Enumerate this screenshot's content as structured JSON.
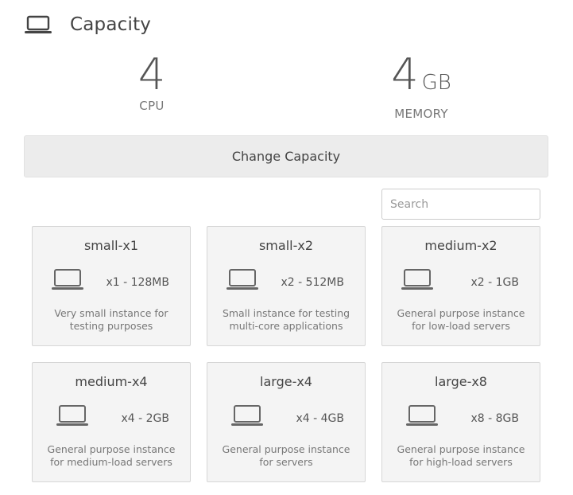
{
  "header": {
    "title": "Capacity",
    "icon": "laptop-icon"
  },
  "metrics": {
    "cpu": {
      "value": "4",
      "label": "CPU"
    },
    "memory": {
      "value": "4",
      "unit": "GB",
      "label": "MEMORY"
    }
  },
  "change_button": {
    "label": "Change Capacity"
  },
  "search": {
    "placeholder": "Search",
    "value": ""
  },
  "flavors": [
    {
      "name": "small-x1",
      "spec": "x1 - 128MB",
      "description": "Very small instance for testing purposes",
      "icon": "laptop-icon"
    },
    {
      "name": "small-x2",
      "spec": "x2 - 512MB",
      "description": "Small instance for testing multi-core applications",
      "icon": "laptop-icon"
    },
    {
      "name": "medium-x2",
      "spec": "x2 - 1GB",
      "description": "General purpose instance for low-load servers",
      "icon": "laptop-icon"
    },
    {
      "name": "medium-x4",
      "spec": "x4 - 2GB",
      "description": "General purpose instance for medium-load servers",
      "icon": "laptop-icon"
    },
    {
      "name": "large-x4",
      "spec": "x4 - 4GB",
      "description": "General purpose instance for servers",
      "icon": "laptop-icon"
    },
    {
      "name": "large-x8",
      "spec": "x8 - 8GB",
      "description": "General purpose instance for high-load servers",
      "icon": "laptop-icon"
    }
  ],
  "colors": {
    "text": "#444444",
    "muted": "#777777",
    "button_bg": "#ececec",
    "card_bg": "#f4f4f4",
    "card_border": "#d6d6d6"
  }
}
